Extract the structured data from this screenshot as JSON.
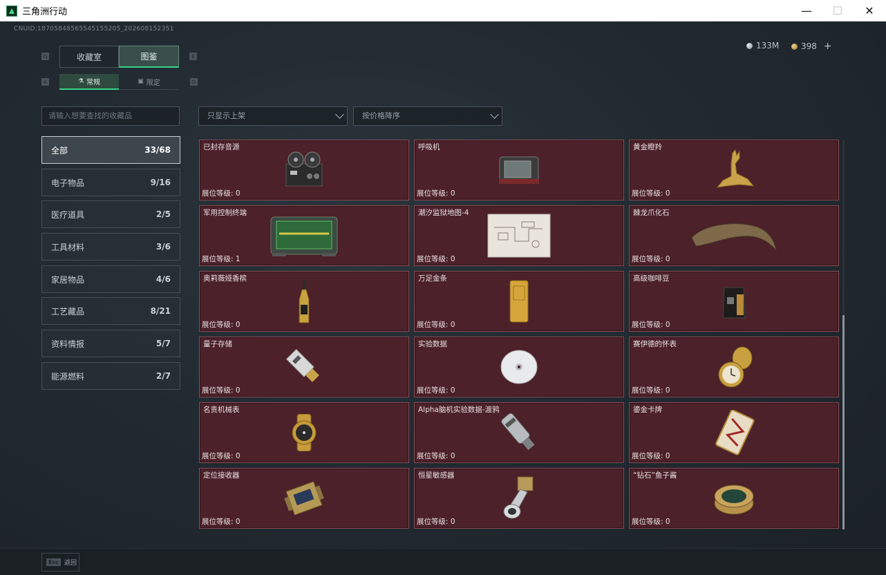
{
  "window": {
    "title": "三角洲行动",
    "minimize": "—",
    "maximize": "☐",
    "close": "✕"
  },
  "uid": "CNUID:18705848565545155205_202608152351",
  "currency": {
    "silver": "133M",
    "gold": "398",
    "add": "+"
  },
  "tabs": [
    {
      "label": "收藏室",
      "active": false
    },
    {
      "label": "图鉴",
      "active": true
    }
  ],
  "subtabs": [
    {
      "label": "常规",
      "icon": "flask-icon",
      "active": true
    },
    {
      "label": "限定",
      "icon": "box-icon",
      "active": false
    }
  ],
  "key_hints": {
    "tab_left": "Q",
    "tab_right": "E",
    "sub_left": "A",
    "sub_right": "D"
  },
  "search": {
    "placeholder": "请输入想要查找的收藏品"
  },
  "filters": {
    "shelf": "只显示上架",
    "sort": "按价格降序"
  },
  "categories": [
    {
      "label": "全部",
      "count": "33/68",
      "active": true
    },
    {
      "label": "电子物品",
      "count": "9/16"
    },
    {
      "label": "医疗道具",
      "count": "2/5"
    },
    {
      "label": "工具材料",
      "count": "3/6"
    },
    {
      "label": "家居物品",
      "count": "4/6"
    },
    {
      "label": "工艺藏品",
      "count": "8/21"
    },
    {
      "label": "资料情报",
      "count": "5/7"
    },
    {
      "label": "能源燃料",
      "count": "2/7"
    }
  ],
  "items": [
    {
      "name": "已封存音源",
      "level": "展位等级: 0",
      "icon": "reel-tape-recorder-icon"
    },
    {
      "name": "呼吸机",
      "level": "展位等级: 0",
      "icon": "ventilator-icon"
    },
    {
      "name": "黄金瞪羚",
      "level": "展位等级: 0",
      "icon": "golden-gazelle-icon"
    },
    {
      "name": "军用控制终端",
      "level": "展位等级: 1",
      "icon": "control-terminal-icon"
    },
    {
      "name": "潮汐监狱地图-4",
      "level": "展位等级: 0",
      "icon": "prison-map-icon"
    },
    {
      "name": "棘龙爪化石",
      "level": "展位等级: 0",
      "icon": "claw-fossil-icon"
    },
    {
      "name": "奥莉薇娅香槟",
      "level": "展位等级: 0",
      "icon": "champagne-bottle-icon"
    },
    {
      "name": "万足金条",
      "level": "展位等级: 0",
      "icon": "gold-bar-icon"
    },
    {
      "name": "高级咖啡豆",
      "level": "展位等级: 0",
      "icon": "coffee-bag-icon"
    },
    {
      "name": "量子存储",
      "level": "展位等级: 0",
      "icon": "usb-drive-icon"
    },
    {
      "name": "实验数据",
      "level": "展位等级: 0",
      "icon": "data-disc-icon"
    },
    {
      "name": "赛伊德的怀表",
      "level": "展位等级: 0",
      "icon": "pocket-watch-icon"
    },
    {
      "name": "名贵机械表",
      "level": "展位等级: 0",
      "icon": "wrist-watch-icon"
    },
    {
      "name": "Alpha脑机实验数据-渡鸦",
      "level": "展位等级: 0",
      "icon": "data-canister-icon"
    },
    {
      "name": "鎏金卡牌",
      "level": "展位等级: 0",
      "icon": "gilded-card-icon"
    },
    {
      "name": "定位接收器",
      "level": "展位等级: 0",
      "icon": "locator-receiver-icon"
    },
    {
      "name": "恒星敏感器",
      "level": "展位等级: 0",
      "icon": "star-sensor-icon"
    },
    {
      "name": "“钻石”鱼子酱",
      "level": "展位等级: 0",
      "icon": "caviar-tin-icon"
    }
  ],
  "footer": {
    "esc_key": "Esc",
    "esc_label": "返回"
  }
}
